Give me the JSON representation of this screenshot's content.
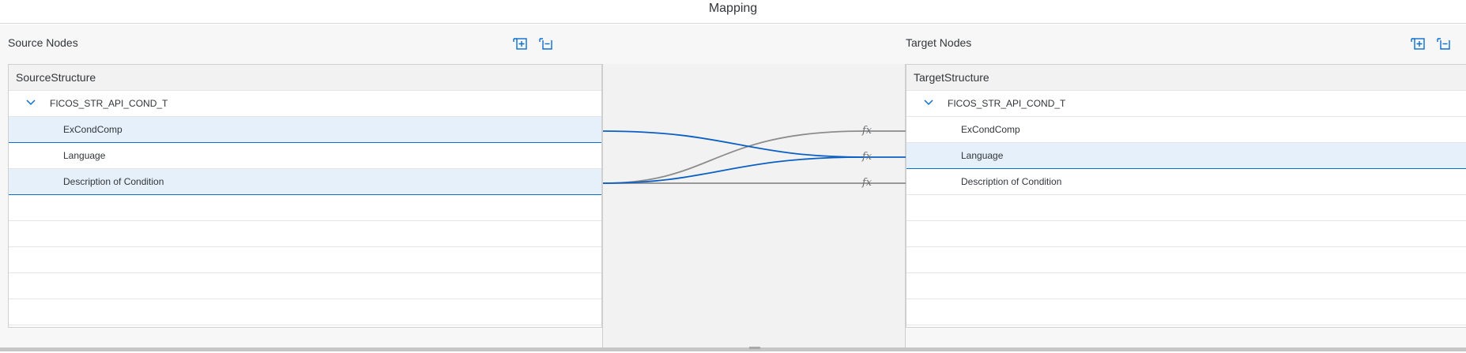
{
  "title": "Mapping",
  "source": {
    "header": "Source Nodes",
    "tree_title": "SourceStructure",
    "root": "FICOS_STR_API_COND_T",
    "children": [
      "ExCondComp",
      "Language",
      "Description of Condition"
    ]
  },
  "target": {
    "header": "Target Nodes",
    "tree_title": "TargetStructure",
    "root": "FICOS_STR_API_COND_T",
    "children": [
      "ExCondComp",
      "Language",
      "Description of Condition"
    ]
  },
  "icons": {
    "expand_all": "expand-all-icon",
    "collapse_all": "collapse-all-icon",
    "function": "fx-icon",
    "chevron": "chevron-down-icon"
  },
  "function_label": "fx",
  "colors": {
    "selected_row": "#e5f0fa",
    "accent": "#0a6ed1",
    "mapping_line_active": "#0a5fc5",
    "mapping_line_inactive": "#8c8c8c"
  }
}
